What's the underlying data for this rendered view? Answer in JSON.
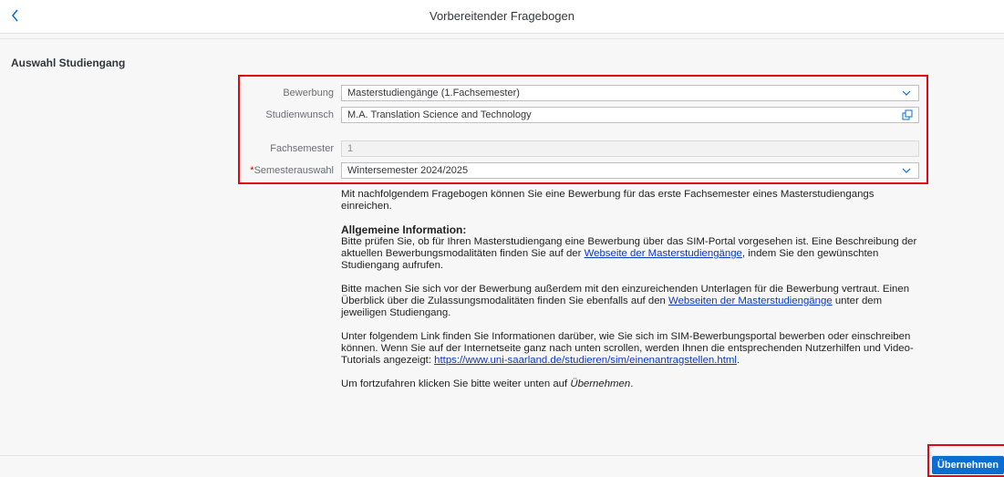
{
  "header": {
    "title": "Vorbereitender Fragebogen",
    "back_icon": "chevron-left-icon"
  },
  "section": {
    "title": "Auswahl Studiengang"
  },
  "form": {
    "bewerbung": {
      "label": "Bewerbung",
      "value": "Masterstudiengänge (1.Fachsemester)"
    },
    "studienwunsch": {
      "label": "Studienwunsch",
      "value": "M.A. Translation Science and Technology"
    },
    "fachsemester": {
      "label": "Fachsemester",
      "value": "1"
    },
    "semesterauswahl": {
      "required_mark": "*",
      "label": "Semesterauswahl",
      "value": "Wintersemester 2024/2025"
    }
  },
  "description": {
    "intro": "Mit nachfolgendem Fragebogen können Sie eine Bewerbung für das erste Fachsemester eines Masterstudiengangs einreichen.",
    "info_heading": "Allgemeine Information:",
    "p1_before": "Bitte prüfen Sie, ob für Ihren Masterstudiengang eine Bewerbung über das SIM-Portal vorgesehen ist. Eine Beschreibung der aktuellen Bewerbungsmodalitäten finden Sie auf der ",
    "p1_link": "Webseite der Masterstudiengänge",
    "p1_after": ", indem Sie den gewünschten Studiengang aufrufen.",
    "p2_before": "Bitte machen Sie sich vor der Bewerbung außerdem mit den einzureichenden Unterlagen für die Bewerbung vertraut. Einen Überblick über die Zulassungsmodalitäten finden Sie ebenfalls auf den ",
    "p2_link": "Webseiten der Masterstudiengänge",
    "p2_after": " unter dem jeweiligen Studiengang.",
    "p3_before": "Unter folgendem Link finden Sie Informationen darüber, wie Sie sich im SIM-Bewerbungsportal bewerben oder einschreiben können. Wenn Sie auf der Internetseite ganz nach unten scrollen, werden Ihnen die entsprechenden Nutzerhilfen und Video-Tutorials angezeigt: ",
    "p3_link": "https://www.uni-saarland.de/studieren/sim/einenantragstellen.html",
    "p3_after": ".",
    "p4_before": "Um fortzufahren klicken Sie bitte weiter unten auf ",
    "p4_em": "Übernehmen",
    "p4_after": "."
  },
  "footer": {
    "submit_label": "Übernehmen"
  },
  "colors": {
    "accent": "#0a6ed1",
    "highlight": "#e30613"
  }
}
